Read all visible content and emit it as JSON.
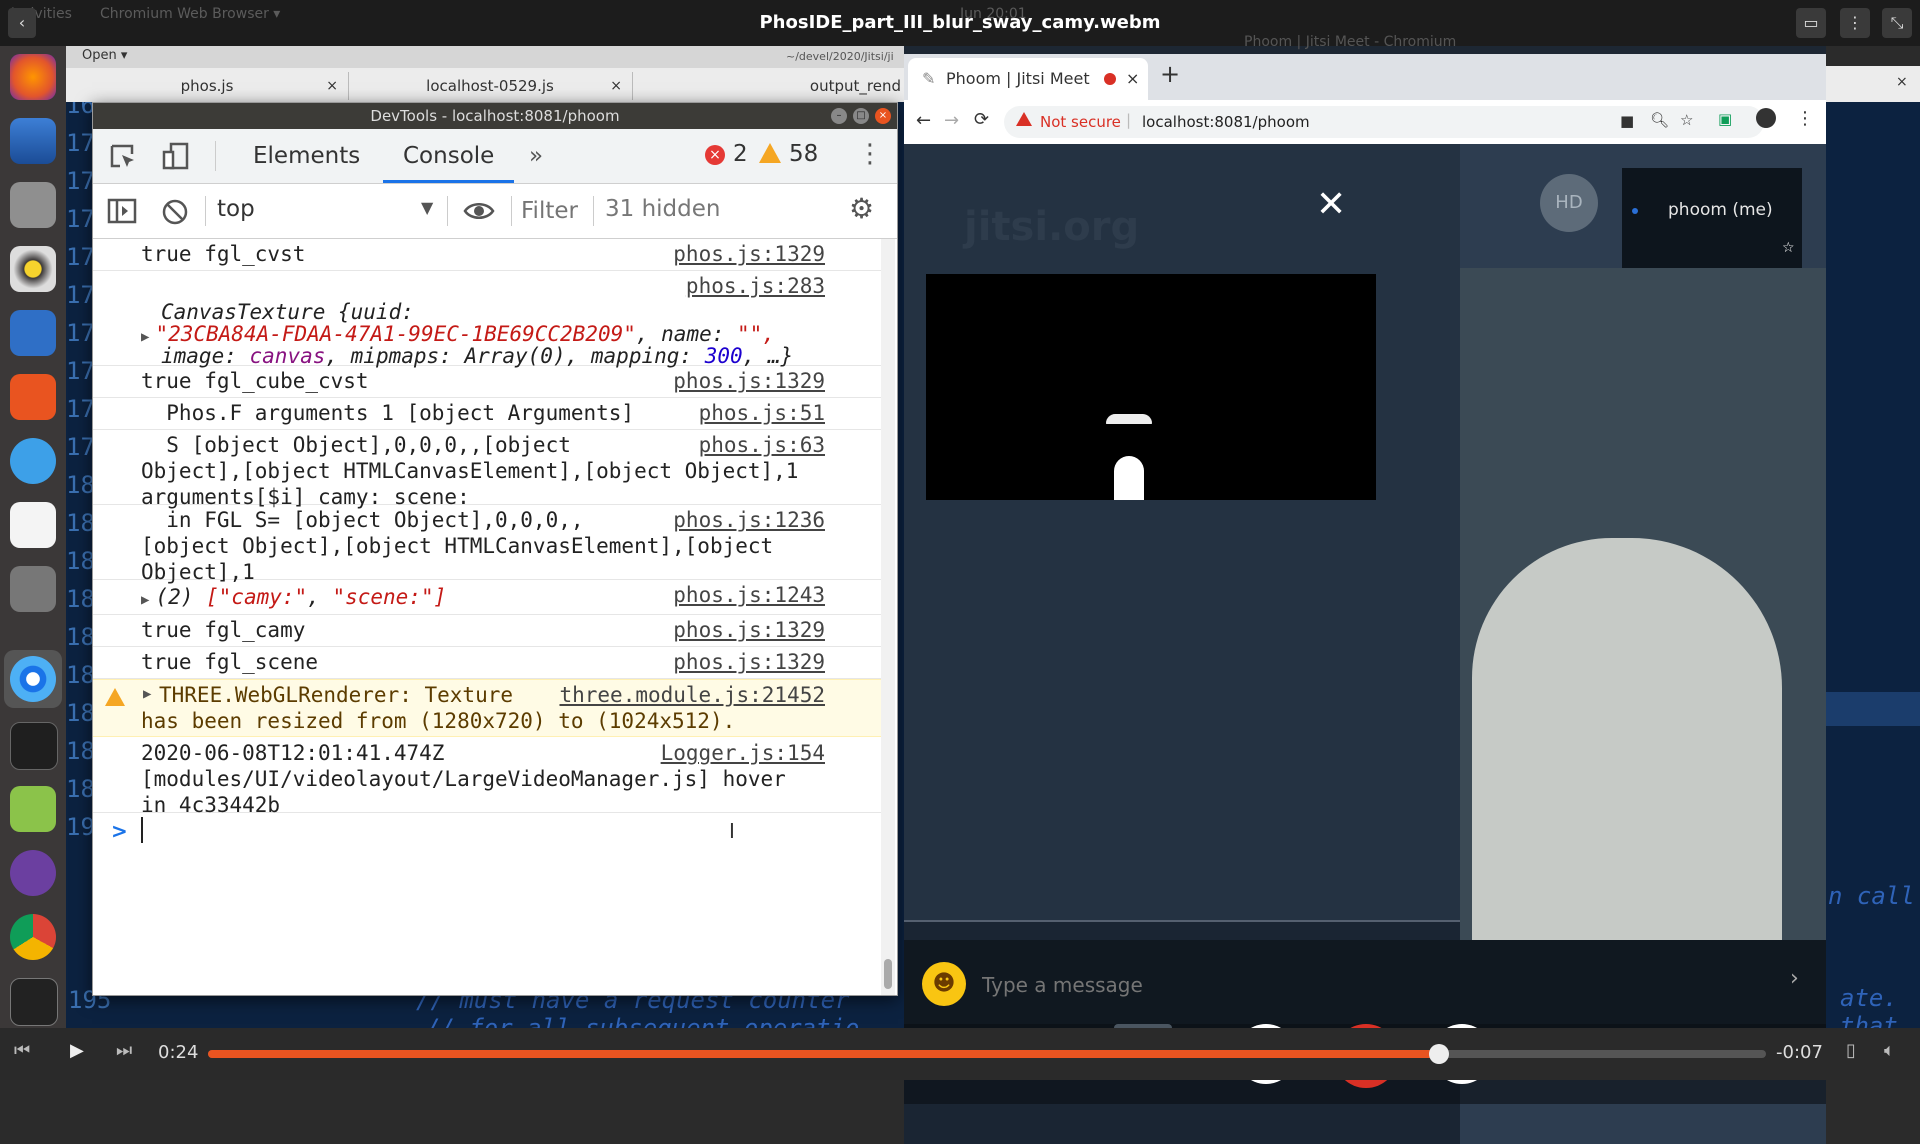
{
  "topbar": {
    "title": "PhosIDE_part_III_blur_sway_camy.webm",
    "activities": "Activities",
    "app_menu": "Chromium Web Browser ▾",
    "clock": "Jun 20:01"
  },
  "editor": {
    "header_open": "Open ▾",
    "header_path": "~/devel/2020/Jitsi/ji",
    "tabs": [
      {
        "label": "phos.js"
      },
      {
        "label": "localhost-0529.js"
      },
      {
        "label": "output_rend"
      }
    ],
    "gutter": [
      "16",
      "17",
      "17",
      "17",
      "17",
      "17",
      "17",
      "17",
      "17",
      "17",
      "18",
      "18",
      "18",
      "18",
      "18",
      "18",
      "18",
      "18",
      "18",
      "19"
    ],
    "bottom_lines": [
      "// must have a request counter",
      "// for all subsequent operatio"
    ],
    "right_fragments": [
      "n call",
      "ate.",
      "that"
    ],
    "line_195": "195"
  },
  "devtools": {
    "window_title": "DevTools - localhost:8081/phoom",
    "tabs": [
      "Elements",
      "Console"
    ],
    "more_tabs": "»",
    "error_count": "2",
    "warn_count": "58",
    "context": "top",
    "filter_placeholder": "Filter",
    "hidden": "31 hidden",
    "rows": [
      {
        "msg": "true fgl_cvst",
        "src": "phos.js:1329"
      },
      {
        "src": "phos.js:283",
        "head": "CanvasTexture {uuid:",
        "uuid": "\"23CBA84A-FDAA-47A1-99EC-1BE69CC2B209\"",
        "name_part": ", name: ",
        "name_val": "\"\",",
        "image_line_a": "image: ",
        "image_val": "canvas",
        "image_line_b": ", mipmaps: ",
        "mipmaps_val": "Array(0)",
        "mapping_label": ", mapping: ",
        "mapping_val": "300",
        "tail": ", …}"
      },
      {
        "msg": "true fgl_cube_cvst",
        "src": "phos.js:1329"
      },
      {
        "msg": "  Phos.F arguments 1 [object Arguments]",
        "src": "phos.js:51"
      },
      {
        "msg": "  S [object Object],0,0,0,,[object\nObject],[object HTMLCanvasElement],[object Object],1\narguments[$i] camy: scene:",
        "src": "phos.js:63"
      },
      {
        "msg": "  in FGL S= [object Object],0,0,0,,\n[object Object],[object HTMLCanvasElement],[object\nObject],1",
        "src": "phos.js:1236"
      },
      {
        "count": "(2) ",
        "arr_a": "[\"camy:\"",
        "comma": ", ",
        "arr_b": "\"scene:\"]",
        "src": "phos.js:1243"
      },
      {
        "msg": "true fgl_camy",
        "src": "phos.js:1329"
      },
      {
        "msg": "true fgl_scene",
        "src": "phos.js:1329"
      },
      {
        "msg": "THREE.WebGLRenderer: Texture\nhas been resized from (1280x720) to (1024x512).",
        "src": "three.module.js:21452"
      },
      {
        "msg": "2020-06-08T12:01:41.474Z\n[modules/UI/videolayout/LargeVideoManager.js] hover\nin 4c33442b",
        "src": "Logger.js:154"
      }
    ],
    "prompt": ">"
  },
  "browser": {
    "tab_title": "Phoom | Jitsi Meet",
    "new_tab": "+",
    "bg_title": "Phoom | Jitsi Meet - Chromium",
    "security": "Not secure",
    "url": "localhost:8081/phoom",
    "watermark": "jitsi.org",
    "room_name": "Phoom",
    "avatar_initials": "HD",
    "self_label": "phoom (me)",
    "chat_placeholder": "Type a message"
  },
  "player": {
    "elapsed": "0:24",
    "remaining": "-0:07",
    "progress": 0.79
  },
  "colors": {
    "accent": "#1a73e8",
    "error": "#e53935",
    "warning": "#f5a623",
    "hangup": "#d93025"
  }
}
